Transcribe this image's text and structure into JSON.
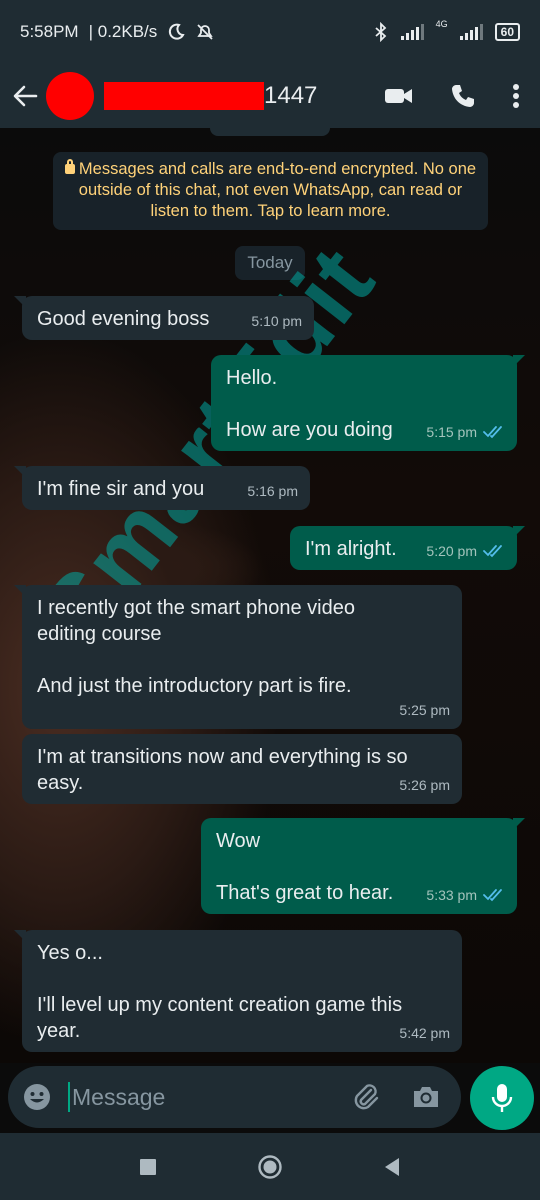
{
  "status_bar": {
    "time": "5:58PM",
    "speed": "| 0.2KB/s",
    "network_label": "4G",
    "battery": "60"
  },
  "header": {
    "contact_name": "1447"
  },
  "chat": {
    "encryption_notice": "Messages and calls are end-to-end encrypted. No one outside of this chat, not even WhatsApp, can read or listen to them. Tap to learn more.",
    "date_chip": "Today",
    "messages": [
      {
        "direction": "in",
        "text": "Good evening boss",
        "time": "5:10 pm"
      },
      {
        "direction": "out",
        "text": "Hello.\n\nHow are you doing",
        "time": "5:15 pm",
        "status": "read"
      },
      {
        "direction": "in",
        "text": "I'm fine sir and you",
        "time": "5:16 pm"
      },
      {
        "direction": "out",
        "text": "I'm alright.",
        "time": "5:20 pm",
        "status": "read"
      },
      {
        "direction": "in",
        "text": "I recently got the smart phone video\nediting course\n\nAnd just the introductory part is fire.",
        "time": "5:25 pm"
      },
      {
        "direction": "in",
        "text": "I'm at transitions now and everything is so\neasy.",
        "time": "5:26 pm"
      },
      {
        "direction": "out",
        "text": "Wow\n\nThat's great to hear.",
        "time": "5:33 pm",
        "status": "read"
      },
      {
        "direction": "in",
        "text": "Yes o...\n\nI'll level up my content creation game  this\nyear.",
        "time": "5:42 pm"
      }
    ],
    "watermark": "SmartEdit"
  },
  "input": {
    "placeholder": "Message"
  },
  "colors": {
    "header_bg": "#1f2c33",
    "incoming_bubble": "#202c33",
    "outgoing_bubble": "#005c4b",
    "accent": "#00a884",
    "read_ticks": "#53bdeb",
    "encryption_text": "#ffd279"
  }
}
